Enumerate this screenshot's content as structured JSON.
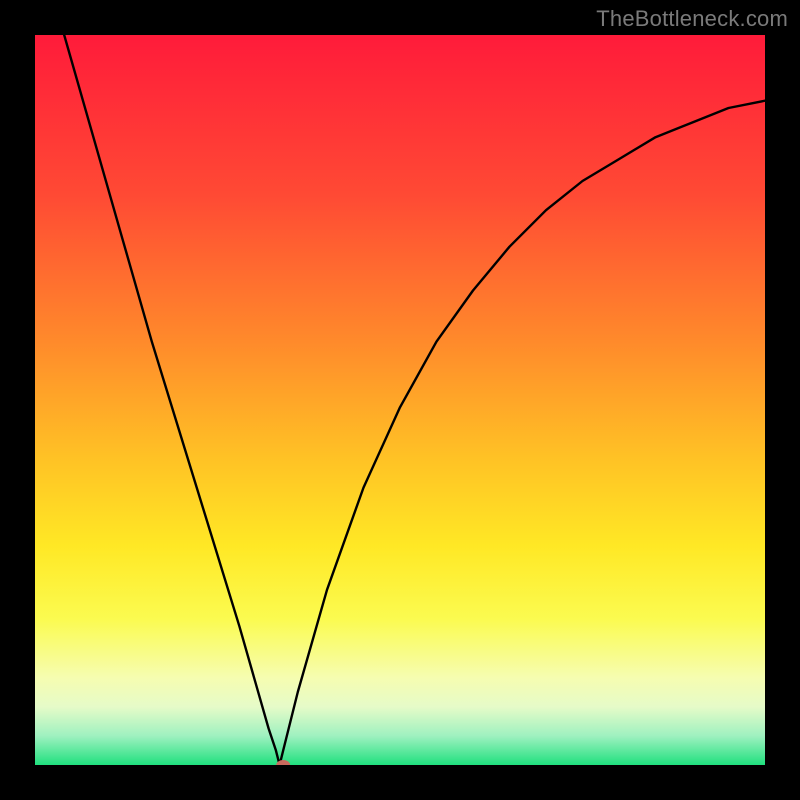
{
  "watermark": "TheBottleneck.com",
  "chart_data": {
    "type": "line",
    "title": "",
    "xlabel": "",
    "ylabel": "",
    "xlim": [
      0,
      100
    ],
    "ylim": [
      0,
      100
    ],
    "grid": false,
    "legend": "none",
    "gradient_stops": [
      {
        "y_pct": 0,
        "color": "#ff1b3a"
      },
      {
        "y_pct": 22,
        "color": "#ff4a34"
      },
      {
        "y_pct": 42,
        "color": "#ff8a2b"
      },
      {
        "y_pct": 58,
        "color": "#ffc225"
      },
      {
        "y_pct": 70,
        "color": "#ffe825"
      },
      {
        "y_pct": 80,
        "color": "#fbfb50"
      },
      {
        "y_pct": 88,
        "color": "#f6fdb0"
      },
      {
        "y_pct": 92,
        "color": "#e6fbc8"
      },
      {
        "y_pct": 96,
        "color": "#9ff1c0"
      },
      {
        "y_pct": 100,
        "color": "#20e07e"
      }
    ],
    "series": [
      {
        "name": "curve",
        "x": [
          4,
          8,
          12,
          16,
          20,
          24,
          28,
          30,
          32,
          33,
          33.5,
          34,
          36,
          40,
          45,
          50,
          55,
          60,
          65,
          70,
          75,
          80,
          85,
          90,
          95,
          100
        ],
        "y": [
          100,
          86,
          72,
          58,
          45,
          32,
          19,
          12,
          5,
          2,
          0,
          2,
          10,
          24,
          38,
          49,
          58,
          65,
          71,
          76,
          80,
          83,
          86,
          88,
          90,
          91
        ]
      }
    ],
    "marker": {
      "x": 34,
      "y": 0,
      "color": "#c96a5e",
      "rx": 7,
      "ry": 5
    }
  }
}
